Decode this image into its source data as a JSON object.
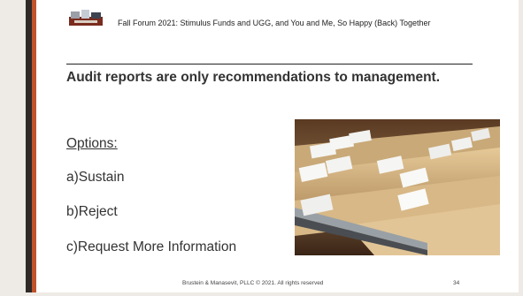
{
  "slide": {
    "header": "Fall Forum 2021: Stimulus Funds and UGG, and You and Me, So Happy (Back) Together",
    "heading": "Audit reports are only recommendations to management.",
    "options_label": "Options:",
    "options": [
      "a)Sustain",
      "b)Reject",
      "c)Request More Information"
    ],
    "footer": "Brustein & Manasevit, PLLC © 2021. All rights reserved",
    "page_number": "34"
  },
  "colors": {
    "accent": "#c0532b",
    "dark_bar": "#2e2a28",
    "frame": "#eeebe6"
  },
  "images": {
    "logo": "firm-logo-image",
    "photo": "file-folders-photo"
  }
}
